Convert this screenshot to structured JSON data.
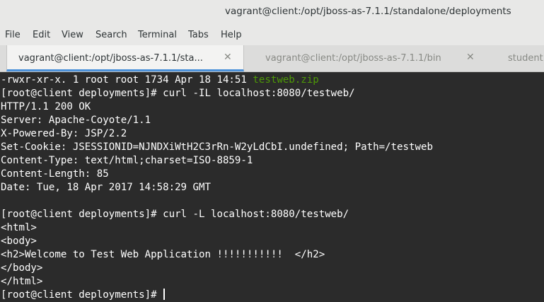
{
  "window": {
    "title": "vagrant@client:/opt/jboss-as-7.1.1/standalone/deployments"
  },
  "menu": {
    "file": "File",
    "edit": "Edit",
    "view": "View",
    "search": "Search",
    "terminal": "Terminal",
    "tabs": "Tabs",
    "help": "Help"
  },
  "tabs": [
    {
      "label": "vagrant@client:/opt/jboss-as-7.1.1/sta...",
      "close": "✕",
      "active": true
    },
    {
      "label": "vagrant@client:/opt/jboss-as-7.1.1/bin",
      "close": "✕",
      "active": false
    },
    {
      "label": "student",
      "close": "",
      "active": false
    }
  ],
  "terminal": {
    "line0_prefix": "-rwxr-xr-x. 1 root root 1734 Apr 18 14:51 ",
    "line0_file": "testweb.zip",
    "line1": "[root@client deployments]# curl -IL localhost:8080/testweb/",
    "line2": "HTTP/1.1 200 OK",
    "line3": "Server: Apache-Coyote/1.1",
    "line4": "X-Powered-By: JSP/2.2",
    "line5": "Set-Cookie: JSESSIONID=NJNDXiWtH2C3rRn-W2yLdCbI.undefined; Path=/testweb",
    "line6": "Content-Type: text/html;charset=ISO-8859-1",
    "line7": "Content-Length: 85",
    "line8": "Date: Tue, 18 Apr 2017 14:58:29 GMT",
    "line9": "",
    "line10": "[root@client deployments]# curl -L localhost:8080/testweb/",
    "line11": "<html>",
    "line12": "<body>",
    "line13": "<h2>Welcome to Test Web Application !!!!!!!!!!!  </h2>",
    "line14": "</body>",
    "line15": "</html>",
    "line16_prompt": "[root@client deployments]# "
  },
  "colors": {
    "terminal_bg": "#2b2b2b",
    "terminal_fg": "#ffffff",
    "filename_green": "#4e9a06",
    "tab_accent": "#4a90d9"
  }
}
